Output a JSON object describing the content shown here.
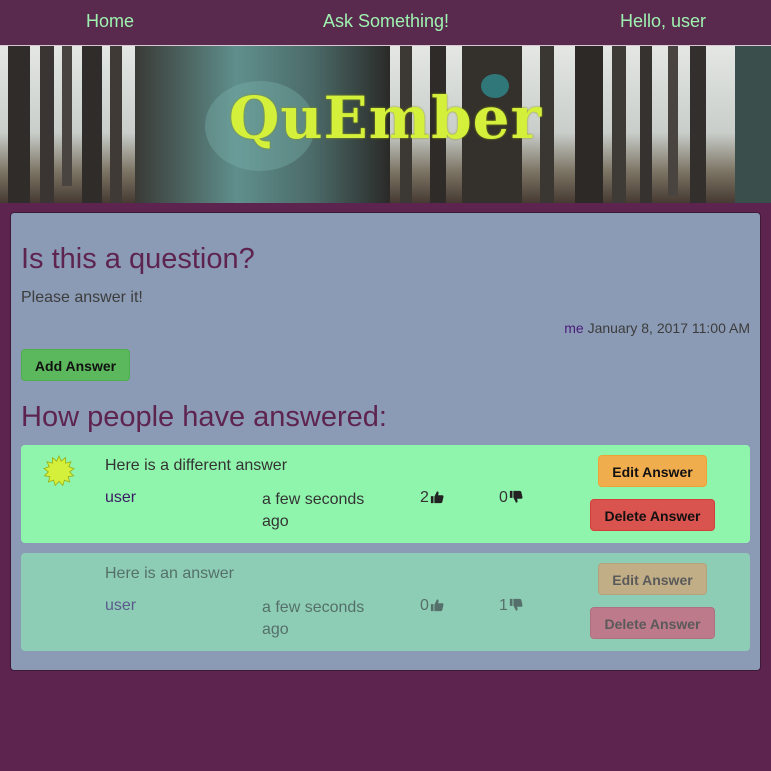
{
  "nav": {
    "home": "Home",
    "ask": "Ask Something!",
    "greeting": "Hello, user"
  },
  "banner": {
    "logo": "QuEmber"
  },
  "question": {
    "title": "Is this a question?",
    "body": "Please answer it!",
    "author": "me",
    "timestamp": "January 8, 2017 11:00 AM",
    "add_answer_label": "Add Answer"
  },
  "answers_heading": "How people have answered:",
  "answers": [
    {
      "text": "Here is a different answer",
      "user": "user",
      "time": "a few seconds ago",
      "upvotes": "2",
      "downvotes": "0",
      "edit_label": "Edit Answer",
      "delete_label": "Delete Answer",
      "badge": "starburst-badge-icon"
    },
    {
      "text": "Here is an answer",
      "user": "user",
      "time": "a few seconds ago",
      "upvotes": "0",
      "downvotes": "1",
      "edit_label": "Edit Answer",
      "delete_label": "Delete Answer"
    }
  ],
  "colors": {
    "page_bg": "#5e2450",
    "panel_bg": "#8b9bb5",
    "nav_link": "#9ef2b0",
    "logo": "#d4f03a",
    "answer_highlight": "#90f5ac",
    "answer_dim": "#8ecdb5"
  }
}
